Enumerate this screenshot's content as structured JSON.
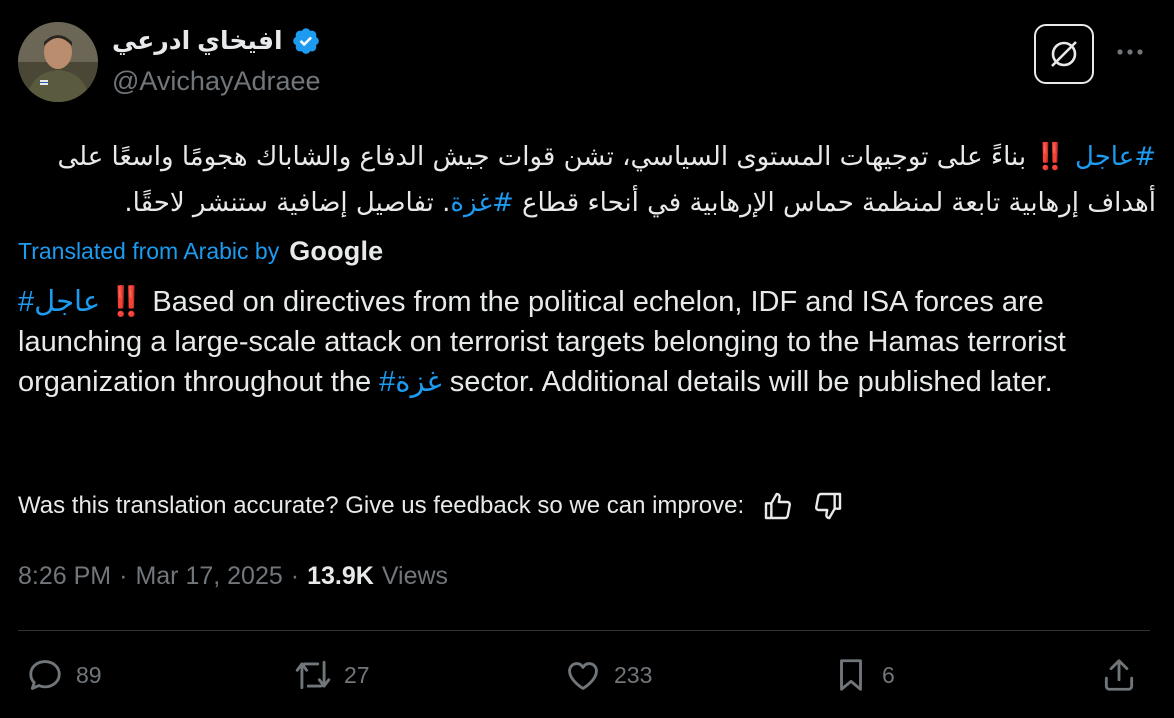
{
  "author": {
    "display_name": "افيخاي ادرعي",
    "handle": "@AvichayAdraee",
    "verified": true
  },
  "tweet": {
    "arabic_hashtag_urgent": "#عاجل",
    "arabic_bangs": "‼️",
    "arabic_part1": " بناءً على توجيهات المستوى السياسي، تشن قوات جيش الدفاع والشاباك هجومًا واسعًا على أهداف إرهابية تابعة لمنظمة حماس الإرهابية في أنحاء قطاع ",
    "arabic_hashtag_gaza": "#غزة",
    "arabic_part2": ". تفاصيل إضافية ستنشر لاحقًا.",
    "translated_label": "Translated from Arabic by",
    "translator": "Google",
    "english_hashtag_urgent": "#عاجل",
    "english_bangs": "‼️",
    "english_part1": " Based on directives from the political echelon, IDF and ISA forces are launching a large-scale attack on terrorist targets belonging to the Hamas terrorist organization throughout the ",
    "english_hashtag_gaza": "#غزة",
    "english_part2": " sector. Additional details will be published later.",
    "feedback_prompt": "Was this translation accurate? Give us feedback so we can improve:"
  },
  "meta": {
    "time": "8:26 PM",
    "sep1": "·",
    "date": "Mar 17, 2025",
    "sep2": "·",
    "views_count": "13.9K",
    "views_label": "Views"
  },
  "actions": {
    "replies": "89",
    "reposts": "27",
    "likes": "233",
    "bookmarks": "6"
  },
  "icons": [
    "verified-badge-icon",
    "grok-icon",
    "more-icon",
    "thumbs-up-icon",
    "thumbs-down-icon",
    "reply-icon",
    "repost-icon",
    "like-icon",
    "bookmark-icon",
    "share-icon"
  ],
  "colors": {
    "background": "#000000",
    "text": "#e7e9ea",
    "muted": "#71767b",
    "link": "#1d9bf0",
    "verified": "#1d9bf0"
  }
}
